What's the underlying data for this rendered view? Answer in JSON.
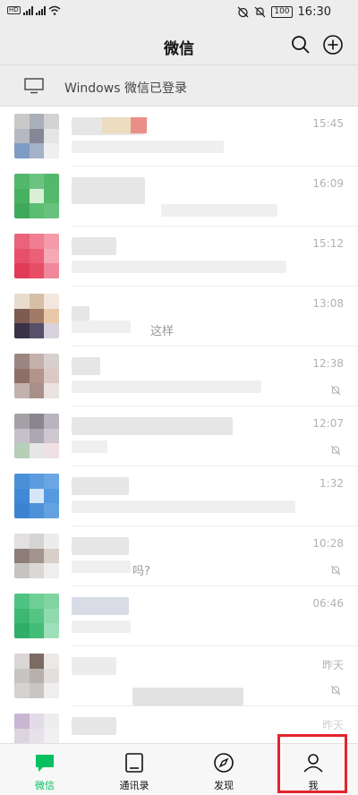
{
  "status_bar": {
    "time": "16:30",
    "battery": "100",
    "network_badge": "HD"
  },
  "header": {
    "title": "微信"
  },
  "banner": {
    "text": "Windows 微信已登录"
  },
  "chats": [
    {
      "time": "15:45",
      "muted": false,
      "snippet": ""
    },
    {
      "time": "16:09",
      "muted": false,
      "snippet": ""
    },
    {
      "time": "15:12",
      "muted": false,
      "snippet": ""
    },
    {
      "time": "13:08",
      "muted": false,
      "snippet": "这样"
    },
    {
      "time": "12:38",
      "muted": true,
      "snippet": ""
    },
    {
      "time": "12:07",
      "muted": true,
      "snippet": ""
    },
    {
      "time": "1:32",
      "muted": false,
      "snippet": ""
    },
    {
      "time": "10:28",
      "muted": true,
      "snippet": "吗?"
    },
    {
      "time": "06:46",
      "muted": false,
      "snippet": ""
    },
    {
      "time": "昨天",
      "muted": true,
      "snippet": ""
    },
    {
      "time": "昨天",
      "muted": false,
      "snippet": ""
    }
  ],
  "tabs": [
    {
      "label": "微信",
      "icon": "chat-icon",
      "active": true
    },
    {
      "label": "通讯录",
      "icon": "contacts-icon",
      "active": false
    },
    {
      "label": "发现",
      "icon": "compass-icon",
      "active": false
    },
    {
      "label": "我",
      "icon": "person-icon",
      "active": false
    }
  ],
  "colors": {
    "accent_green": "#07c160",
    "highlight_red": "#e3242b",
    "timestamp_gray": "#b2b2b2"
  }
}
